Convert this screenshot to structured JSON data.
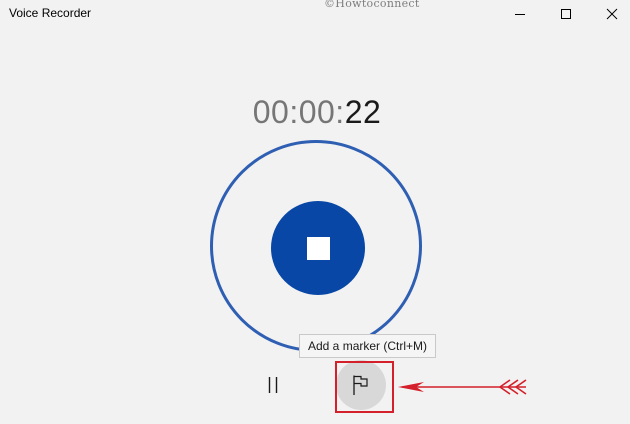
{
  "window": {
    "title": "Voice Recorder",
    "watermark": "©Howtoconnect"
  },
  "window_controls": {
    "minimize_icon": "minimize-icon",
    "maximize_icon": "maximize-icon",
    "close_icon": "close-icon"
  },
  "timer": {
    "dim_part": "00:00:",
    "bright_part": "22"
  },
  "recorder": {
    "stop_icon": "stop-icon",
    "pause_icon": "pause-icon",
    "marker_icon": "flag-icon",
    "accent_color": "#0847a6",
    "ring_color": "#2f5fb3"
  },
  "tooltip": {
    "text": "Add a marker (Ctrl+M)"
  },
  "annotation": {
    "highlight_color": "#d3202a"
  }
}
